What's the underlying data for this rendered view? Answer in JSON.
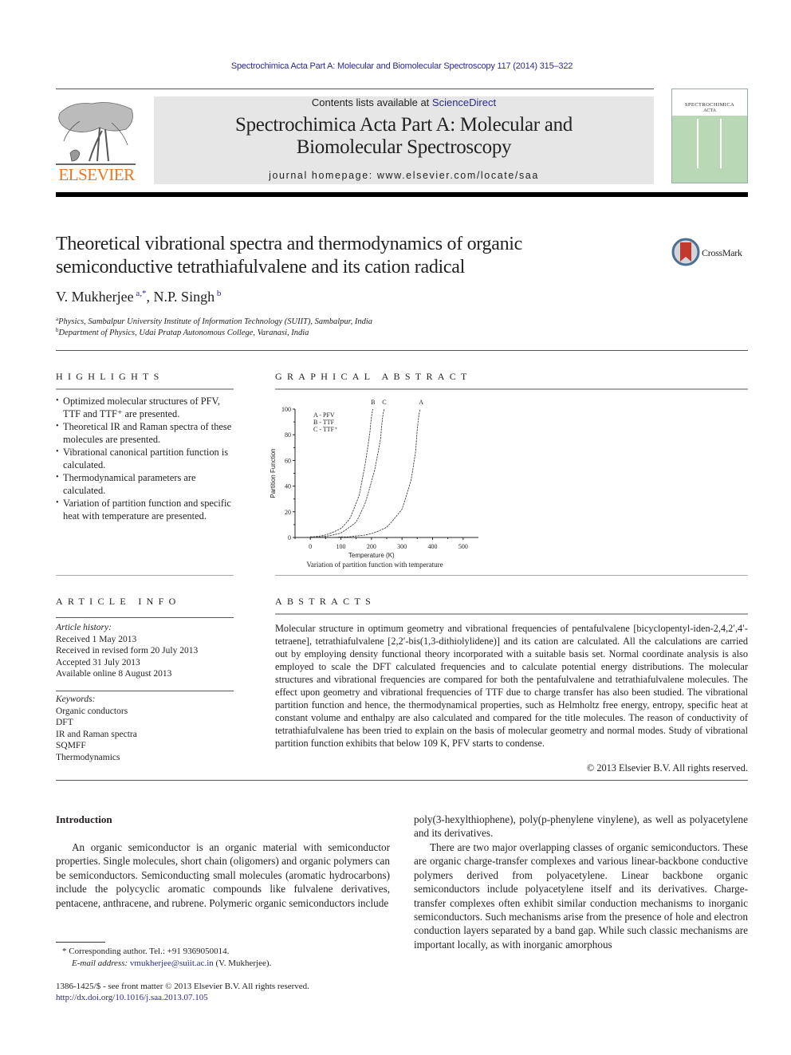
{
  "header": {
    "citation": "Spectrochimica Acta Part A: Molecular and Biomolecular Spectroscopy 117 (2014) 315–322",
    "contents_prefix": "Contents lists available at ",
    "contents_link": "ScienceDirect",
    "journal_title_line1": "Spectrochimica Acta Part A: Molecular and",
    "journal_title_line2": "Biomolecular Spectroscopy",
    "homepage": "journal homepage: www.elsevier.com/locate/saa",
    "publisher_logo_text": "ELSEVIER",
    "cover_title_line1": "SPECTROCHIMICA",
    "cover_title_line2": "ACTA",
    "brand_color": "#e87722",
    "link_color": "#2a2a8c"
  },
  "article": {
    "title_line1": "Theoretical vibrational spectra and thermodynamics of organic",
    "title_line2": "semiconductive tetrathiafulvalene and its cation radical",
    "crossmark_label": "CrossMark",
    "authors": [
      {
        "name": "V. Mukherjee",
        "sup": "a,*"
      },
      {
        "name": "N.P. Singh",
        "sup": "b"
      }
    ],
    "author_separator": ", ",
    "affiliations": [
      {
        "sup": "a",
        "text": "Physics, Sambalpur University Institute of Information Technology (SUIIT), Sambalpur, India"
      },
      {
        "sup": "b",
        "text": "Department of Physics, Udai Pratap Autonomous College, Varanasi, India"
      }
    ]
  },
  "highlights": {
    "heading": "HIGHLIGHTS",
    "items": [
      "Optimized molecular structures of PFV, TTF and TTF⁺ are presented.",
      "Theoretical IR and Raman spectra of these molecules are presented.",
      "Vibrational canonical partition function is calculated.",
      "Thermodynamical parameters are calculated.",
      "Variation of partition function and specific heat with temperature are presented."
    ]
  },
  "graphical_abstract": {
    "heading": "GRAPHICAL ABSTRACT",
    "caption": "Variation of partition function with temperature"
  },
  "chart_data": {
    "type": "line",
    "title": "",
    "xlabel": "Temperature (K)",
    "ylabel": "Partition Function",
    "xlim": [
      -50,
      550
    ],
    "ylim": [
      0,
      100
    ],
    "xticks": [
      0,
      100,
      200,
      300,
      400,
      500
    ],
    "yticks": [
      0,
      20,
      40,
      60,
      80,
      100
    ],
    "legend": [
      "A - PFV",
      "B - TTF",
      "C - TTF⁺"
    ],
    "legend_position": "top-left",
    "series": [
      {
        "name": "A",
        "label": "PFV",
        "x": [
          0,
          50,
          100,
          150,
          200,
          250,
          300,
          330,
          345,
          360
        ],
        "y": [
          0.3,
          0.3,
          0.5,
          1.2,
          3,
          8,
          22,
          45,
          68,
          100
        ]
      },
      {
        "name": "B",
        "label": "TTF",
        "x": [
          0,
          50,
          100,
          130,
          160,
          180,
          195,
          205
        ],
        "y": [
          0.5,
          2,
          7,
          15,
          33,
          58,
          82,
          100
        ]
      },
      {
        "name": "C",
        "label": "TTF⁺",
        "x": [
          0,
          50,
          100,
          150,
          180,
          210,
          230,
          242
        ],
        "y": [
          0.4,
          1,
          3.5,
          12,
          27,
          52,
          77,
          100
        ]
      }
    ],
    "grid": false
  },
  "article_info": {
    "heading": "ARTICLE INFO",
    "history_label": "Article history:",
    "history": [
      "Received 1 May 2013",
      "Received in revised form 20 July 2013",
      "Accepted 31 July 2013",
      "Available online 8 August 2013"
    ],
    "keywords_label": "Keywords:",
    "keywords": [
      "Organic conductors",
      "DFT",
      "IR and Raman spectra",
      "SQMFF",
      "Thermodynamics"
    ]
  },
  "abstract": {
    "heading": "ABSTRACTS",
    "text": "Molecular structure in optimum geometry and vibrational frequencies of pentafulvalene [bicyclopentyl-iden-2,4,2′,4′-tetraene], tetrathiafulvalene [2,2′-bis(1,3-dithiolylidene)] and its cation are calculated. All the calculations are carried out by employing density functional theory incorporated with a suitable basis set. Normal coordinate analysis is also employed to scale the DFT calculated frequencies and to calculate potential energy distributions. The molecular structures and vibrational frequencies are compared for both the pentafulvalene and tetrathiafulvalene molecules. The effect upon geometry and vibrational frequencies of TTF due to charge transfer has also been studied. The vibrational partition function and hence, the thermodynamical properties, such as Helmholtz free energy, entropy, specific heat at constant volume and enthalpy are also calculated and compared for the title molecules. The reason of conductivity of tetrathiafulvalene has been tried to explain on the basis of molecular geometry and normal modes. Study of vibrational partition function exhibits that below 109 K, PFV starts to condense.",
    "copyright": "© 2013 Elsevier B.V. All rights reserved."
  },
  "introduction": {
    "heading": "Introduction",
    "para1": "An organic semiconductor is an organic material with semiconductor properties. Single molecules, short chain (oligomers) and organic polymers can be semiconductors. Semiconducting small molecules (aromatic hydrocarbons) include the polycyclic aromatic compounds like fulvalene derivatives, pentacene, anthracene, and rubrene. Polymeric organic semiconductors include",
    "para1_cont": "poly(3-hexylthiophene), poly(p-phenylene vinylene), as well as polyacetylene and its derivatives.",
    "para2": "There are two major overlapping classes of organic semiconductors. These are organic charge-transfer complexes and various linear-backbone conductive polymers derived from polyacetylene. Linear backbone organic semiconductors include polyacetylene itself and its derivatives. Charge-transfer complexes often exhibit similar conduction mechanisms to inorganic semiconductors. Such mechanisms arise from the presence of hole and electron conduction layers separated by a band gap. While such classic mechanisms are important locally, as with inorganic amorphous"
  },
  "footnotes": {
    "corresponding_marker": "*",
    "corresponding": "Corresponding author. Tel.: +91 9369050014.",
    "email_label": "E-mail address:",
    "email": "vmukherjee@suiit.ac.in",
    "email_suffix": "(V. Mukherjee).",
    "issn_line": "1386-1425/$ - see front matter © 2013 Elsevier B.V. All rights reserved.",
    "doi": "http://dx.doi.org/10.1016/j.saa.2013.07.105"
  }
}
